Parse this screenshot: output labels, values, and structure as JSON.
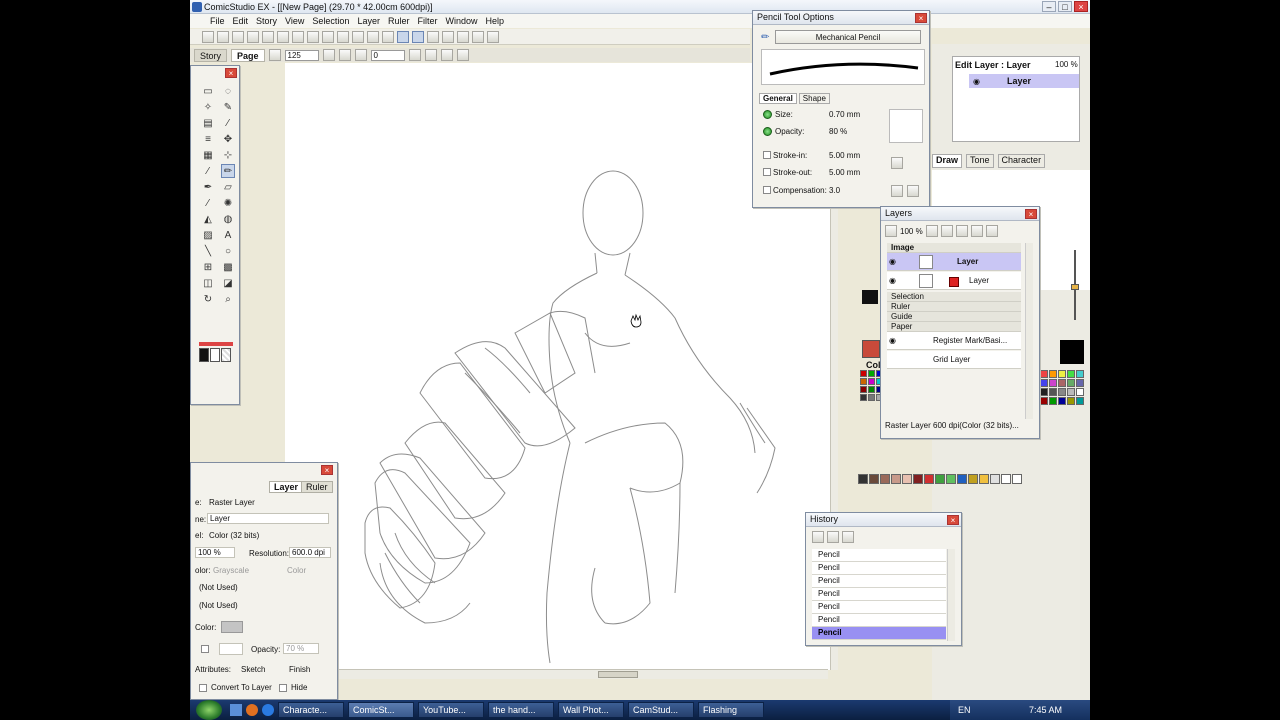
{
  "window": {
    "title": "ComicStudio EX - [[New Page] (29.70 * 42.00cm 600dpi)]"
  },
  "menu": [
    "File",
    "Edit",
    "Story",
    "View",
    "Selection",
    "Layer",
    "Ruler",
    "Filter",
    "Window",
    "Help"
  ],
  "tabs": {
    "story": "Story",
    "page": "Page"
  },
  "toolbar2": {
    "zoom_value": "125",
    "rotate_value": "0"
  },
  "pencil_options": {
    "title": "Pencil Tool Options",
    "preset": "Mechanical Pencil",
    "tabs": [
      "General",
      "Shape"
    ],
    "size_label": "Size:",
    "size_value": "0.70 mm",
    "opacity_label": "Opacity:",
    "opacity_value": "80 %",
    "stroke_in_label": "Stroke-in:",
    "stroke_in_value": "5.00 mm",
    "stroke_out_label": "Stroke-out:",
    "stroke_out_value": "5.00 mm",
    "compensation_label": "Compensation:",
    "compensation_value": "3.0"
  },
  "edit_layer": {
    "label": "Edit Layer : Layer",
    "opacity": "100 %",
    "layer_name": "Layer"
  },
  "brush_tabs": [
    "Draw",
    "Tone",
    "Character"
  ],
  "color_label": "Colo",
  "layers": {
    "title": "Layers",
    "zoom": "100 %",
    "groups": {
      "image": "Image",
      "selection": "Selection",
      "ruler": "Ruler",
      "guide": "Guide",
      "paper": "Paper"
    },
    "rows": [
      {
        "name": "Layer",
        "selected": true
      },
      {
        "name": "Layer",
        "selected": false
      }
    ],
    "paper_rows": [
      "Register Mark/Basi...",
      "Grid Layer"
    ],
    "status": "Raster Layer 600 dpi(Color (32 bits)..."
  },
  "layer_props": {
    "tabs": [
      "Layer",
      "Ruler"
    ],
    "type_label": "e:",
    "type_value": "Raster Layer",
    "name_label": "ne:",
    "name_value": "Layer",
    "mode_label": "el:",
    "mode_value": "Color (32 bits)",
    "zoom": "100 %",
    "resolution_label": "Resolution:",
    "resolution_value": "600.0 dpi",
    "color_label": "olor:",
    "grayscale": "Grayscale",
    "color": "Color",
    "not_used_1": "(Not Used)",
    "not_used_2": "(Not Used)",
    "color2_label": "Color:",
    "opacity_label": "Opacity:",
    "opacity_value": "70 %",
    "attributes_label": "Attributes:",
    "sketch": "Sketch",
    "finish": "Finish",
    "convert_label": "Convert To Layer",
    "hide_label": "Hide"
  },
  "history": {
    "title": "History",
    "items": [
      "Pencil",
      "Pencil",
      "Pencil",
      "Pencil",
      "Pencil",
      "Pencil",
      "Pencil"
    ]
  },
  "taskbar": {
    "tasks": [
      "Characte...",
      "ComicSt...",
      "YouTube...",
      "the hand...",
      "Wall Phot...",
      "CamStud...",
      "Flashing"
    ],
    "lang": "EN",
    "time": "7:45 AM"
  },
  "colors": {
    "accent_selected": "#9890f2",
    "layer_selected": "#c9c6f4"
  },
  "icons": [
    "pencil-icon",
    "eye-icon",
    "folder-icon",
    "trash-icon",
    "undo-icon",
    "redo-icon",
    "hand-cursor-icon"
  ]
}
